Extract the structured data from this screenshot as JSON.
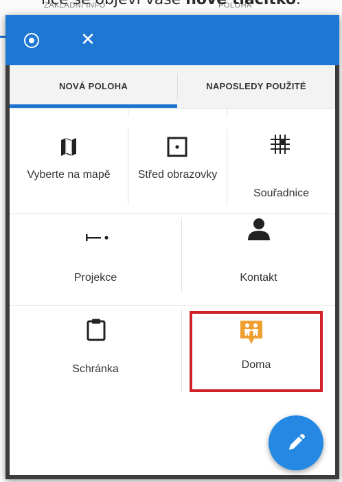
{
  "background": {
    "caption_prefix": "nce se objeví vaše ",
    "caption_bold": "nové tlačítko",
    "caption_suffix": ".",
    "tab_left": "ZÁKLADNÍ INFO",
    "tab_right": "POLOHA"
  },
  "dialog": {
    "tabs": [
      {
        "label": "NOVÁ POLOHA",
        "active": true
      },
      {
        "label": "NAPOSLEDY POUŽITÉ",
        "active": false
      }
    ],
    "options": [
      {
        "label": "Vyberte na mapě",
        "icon": "map-icon"
      },
      {
        "label": "Střed obrazovky",
        "icon": "screen-center-icon"
      },
      {
        "label": "Souřadnice",
        "icon": "coordinates-grid-icon"
      },
      {
        "label": "Projekce",
        "icon": "projection-icon"
      },
      {
        "label": "Kontakt",
        "icon": "contact-person-icon"
      },
      {
        "label": "Schránka",
        "icon": "clipboard-icon"
      },
      {
        "label": "Doma",
        "icon": "home-family-pin-icon"
      }
    ]
  },
  "colors": {
    "appbar": "#1e78d3",
    "tab_indicator": "#1a73d1",
    "highlight_box": "#d0202a",
    "fab": "#2588e3",
    "home_pin": "#f0a030"
  }
}
